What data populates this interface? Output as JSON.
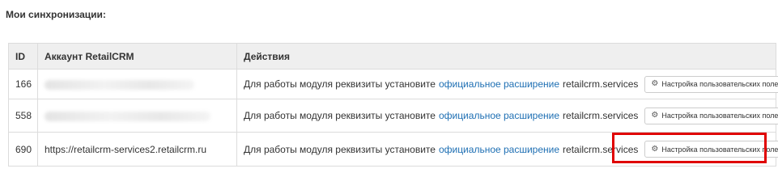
{
  "section_title": "Мои синхронизации:",
  "table": {
    "headers": [
      "ID",
      "Аккаунт RetailCRM",
      "Действия"
    ],
    "rows": [
      {
        "id": "166",
        "account": "",
        "account_blurred": true
      },
      {
        "id": "558",
        "account": "",
        "account_blurred": true
      },
      {
        "id": "690",
        "account": "https://retailcrm-services2.retailcrm.ru",
        "account_blurred": false
      }
    ],
    "action_text": "Для работы модуля реквизиты установите",
    "action_link": "официальное расширение",
    "action_suffix": "retailcrm.services",
    "button_label": "Настройка пользовательских полей",
    "button_icon": "gears-icon"
  },
  "colors": {
    "link": "#1e6fb3",
    "highlight": "#e00000",
    "header_bg": "#efefef"
  }
}
